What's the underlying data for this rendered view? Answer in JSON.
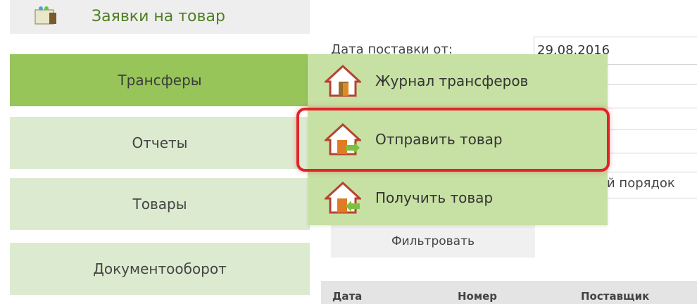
{
  "header": {
    "title": "Заявки на товар",
    "icon": "folder-people-icon"
  },
  "menu": {
    "items": [
      {
        "label": "Трансферы",
        "active": true
      },
      {
        "label": "Отчеты"
      },
      {
        "label": "Товары"
      },
      {
        "label": "Документооборот"
      }
    ]
  },
  "submenu": {
    "items": [
      {
        "label": "Журнал трансферов",
        "icon": "house-door-icon"
      },
      {
        "label": "Отправить товар",
        "icon": "house-send-icon",
        "highlighted": true
      },
      {
        "label": "Получить товар",
        "icon": "house-receive-icon"
      }
    ]
  },
  "form": {
    "date_label": "Дата поставки от:",
    "date_value": "29.08.2016",
    "sort_text": "й порядок",
    "filter_button": "Фильтровать"
  },
  "table": {
    "headers": [
      "Дата",
      "Номер",
      "Поставщик"
    ]
  },
  "colors": {
    "active_menu": "#97c55a",
    "inactive_menu": "#dcebd0",
    "submenu_bg": "#c7e0a4",
    "highlight": "#e0242a"
  }
}
